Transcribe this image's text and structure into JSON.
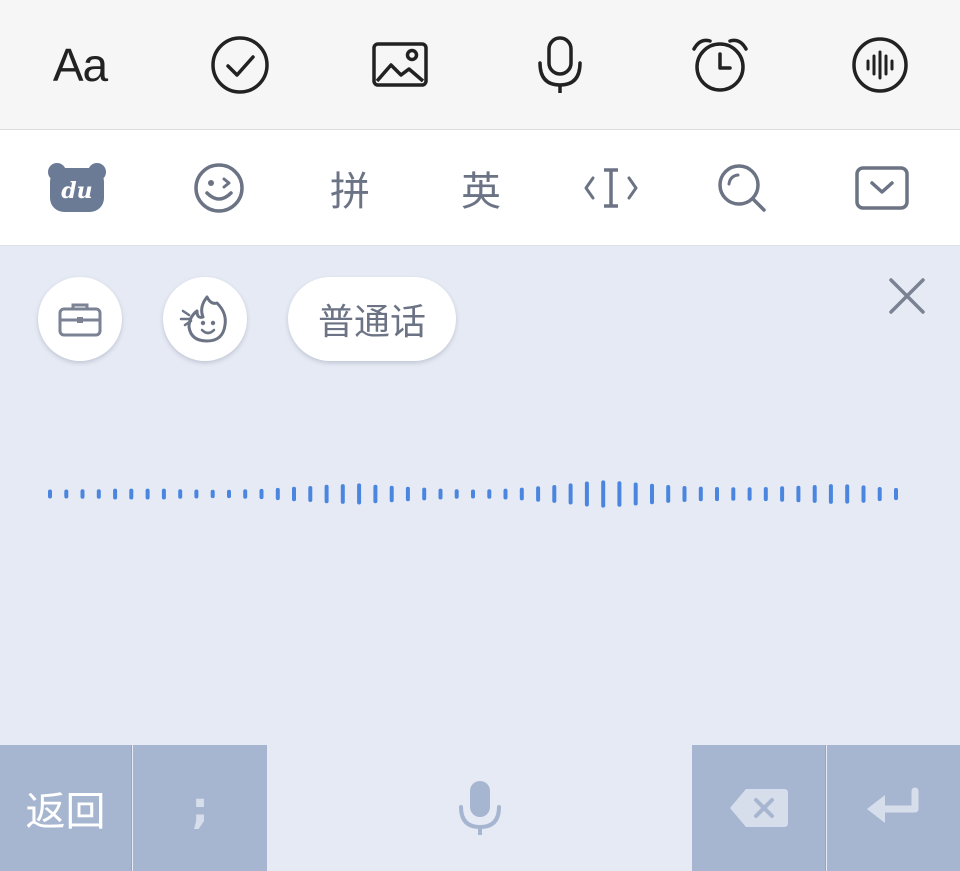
{
  "toolbar": {
    "font_label": "Aa",
    "icons": [
      "font-icon",
      "check-circle-icon",
      "image-icon",
      "microphone-icon",
      "alarm-clock-icon",
      "voice-wave-icon"
    ]
  },
  "keyboard_toolbar": {
    "logo": "du",
    "pinyin_label": "拼",
    "english_label": "英",
    "icons": [
      "du-bear-logo-icon",
      "emoji-icon",
      "cursor-move-icon",
      "search-icon",
      "hide-keyboard-icon"
    ]
  },
  "voice_panel": {
    "language_label": "普通话",
    "wave_levels": [
      0.28,
      0.28,
      0.3,
      0.3,
      0.34,
      0.34,
      0.34,
      0.34,
      0.3,
      0.28,
      0.26,
      0.26,
      0.3,
      0.32,
      0.38,
      0.45,
      0.5,
      0.58,
      0.62,
      0.66,
      0.58,
      0.52,
      0.45,
      0.4,
      0.34,
      0.3,
      0.28,
      0.3,
      0.34,
      0.4,
      0.48,
      0.56,
      0.66,
      0.78,
      0.85,
      0.8,
      0.72,
      0.64,
      0.56,
      0.5,
      0.46,
      0.44,
      0.42,
      0.42,
      0.44,
      0.48,
      0.52,
      0.56,
      0.62,
      0.6,
      0.54,
      0.44,
      0.38
    ]
  },
  "bottom_keys": {
    "back_label": "返回",
    "semicolon_label": ";"
  },
  "colors": {
    "wave": "#4a86e0",
    "icon_gray": "#6b7384",
    "panel_bg": "#e6eaf4",
    "key_blue": "#a7b6d0"
  }
}
